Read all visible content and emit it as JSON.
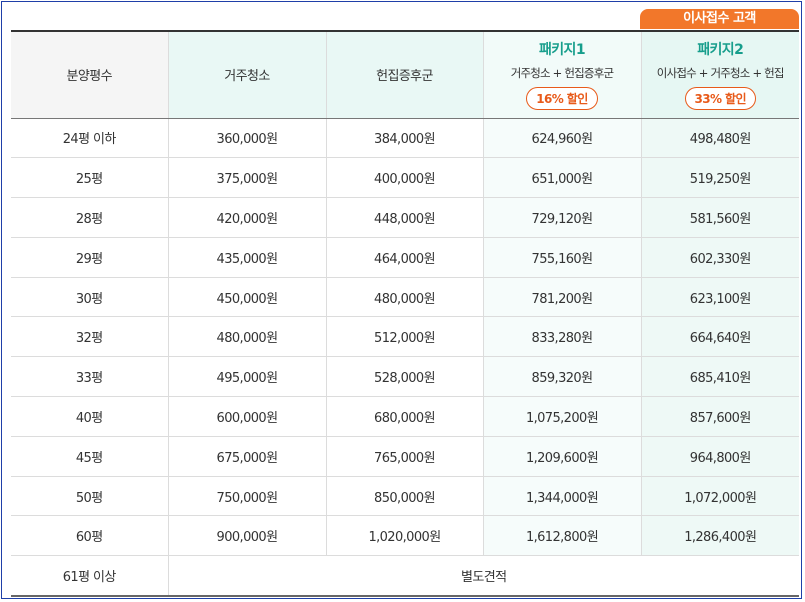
{
  "badge": "이사접수 고객",
  "headers": {
    "size": "분양평수",
    "residential": "거주청소",
    "house_moving": "헌집증후군",
    "package1": {
      "title": "패키지1",
      "desc": "거주청소 + 헌집증후군",
      "discount": "16% 할인"
    },
    "package2": {
      "title": "패키지2",
      "desc": "이사접수 + 거주청소 + 헌집",
      "discount": "33% 할인"
    }
  },
  "rows": [
    [
      "24평 이하",
      "360,000원",
      "384,000원",
      "624,960원",
      "498,480원"
    ],
    [
      "25평",
      "375,000원",
      "400,000원",
      "651,000원",
      "519,250원"
    ],
    [
      "28평",
      "420,000원",
      "448,000원",
      "729,120원",
      "581,560원"
    ],
    [
      "29평",
      "435,000원",
      "464,000원",
      "755,160원",
      "602,330원"
    ],
    [
      "30평",
      "450,000원",
      "480,000원",
      "781,200원",
      "623,100원"
    ],
    [
      "32평",
      "480,000원",
      "512,000원",
      "833,280원",
      "664,640원"
    ],
    [
      "33평",
      "495,000원",
      "528,000원",
      "859,320원",
      "685,410원"
    ],
    [
      "40평",
      "600,000원",
      "680,000원",
      "1,075,200원",
      "857,600원"
    ],
    [
      "45평",
      "675,000원",
      "765,000원",
      "1,209,600원",
      "964,800원"
    ],
    [
      "50평",
      "750,000원",
      "850,000원",
      "1,344,000원",
      "1,072,000원"
    ],
    [
      "60평",
      "900,000원",
      "1,020,000원",
      "1,612,800원",
      "1,286,400원"
    ]
  ],
  "last_row": {
    "size": "61평 이상",
    "note": "별도견적"
  }
}
